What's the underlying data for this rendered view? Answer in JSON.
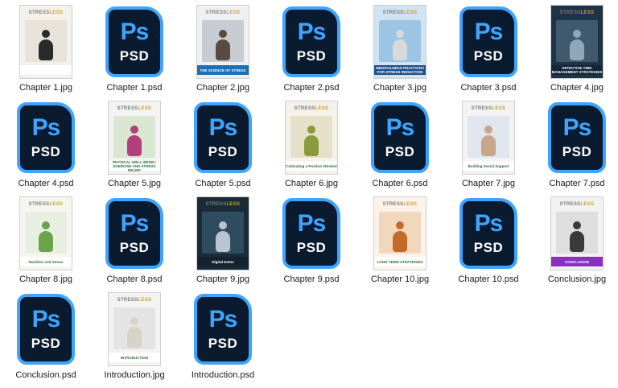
{
  "files": [
    {
      "name": "Chapter 1.jpg",
      "kind": "jpg",
      "theme": {
        "bg": "#f4f1ec",
        "art": "#e7e2da",
        "band": "#ffffff",
        "bandText": "",
        "figure": "#2a2a2a"
      }
    },
    {
      "name": "Chapter 1.psd",
      "kind": "psd"
    },
    {
      "name": "Chapter 2.jpg",
      "kind": "jpg",
      "theme": {
        "bg": "#eef0f2",
        "art": "#c7ccd2",
        "band": "#1c6fb5",
        "bandText": "THE SCIENCE OF STRESS",
        "figure": "#5a4a3f"
      }
    },
    {
      "name": "Chapter 2.psd",
      "kind": "psd"
    },
    {
      "name": "Chapter 3.jpg",
      "kind": "jpg",
      "theme": {
        "bg": "#cfe3f2",
        "art": "#9cc4e4",
        "band": "#1f4f8a",
        "bandText": "MINDFULNESS PRACTICES FOR STRESS REDUCTION",
        "figure": "#d9d9d9"
      }
    },
    {
      "name": "Chapter 3.psd",
      "kind": "psd"
    },
    {
      "name": "Chapter 4.jpg",
      "kind": "jpg",
      "theme": {
        "bg": "#1f3346",
        "art": "#3f5a6f",
        "band": "#13253a",
        "bandText": "EFFECTIVE TIME MANAGEMENT STRATEGIES",
        "figure": "#8fa7b8"
      }
    },
    {
      "name": "Chapter 4.psd",
      "kind": "psd"
    },
    {
      "name": "Chapter 5.jpg",
      "kind": "jpg",
      "theme": {
        "bg": "#f3f3f3",
        "art": "#d8e6d2",
        "band": "#ffffff",
        "bandText": "PHYSICAL WELL-BEING: EXERCISE AND STRESS RELIEF",
        "figure": "#b0407a"
      }
    },
    {
      "name": "Chapter 5.psd",
      "kind": "psd"
    },
    {
      "name": "Chapter 6.jpg",
      "kind": "jpg",
      "theme": {
        "bg": "#f4f2ea",
        "art": "#e6e0c9",
        "band": "#ffffff",
        "bandText": "Cultivating a Positive Mindset",
        "figure": "#8a9a3a"
      }
    },
    {
      "name": "Chapter 6.psd",
      "kind": "psd"
    },
    {
      "name": "Chapter 7.jpg",
      "kind": "jpg",
      "theme": {
        "bg": "#f3f3f3",
        "art": "#dfe6ee",
        "band": "#ffffff",
        "bandText": "Building Social Support",
        "figure": "#c9a68a"
      }
    },
    {
      "name": "Chapter 7.psd",
      "kind": "psd"
    },
    {
      "name": "Chapter 8.jpg",
      "kind": "jpg",
      "theme": {
        "bg": "#f6f6f0",
        "art": "#e8efe0",
        "band": "#ffffff",
        "bandText": "Nutrition and Stress",
        "figure": "#6aa34a"
      }
    },
    {
      "name": "Chapter 8.psd",
      "kind": "psd"
    },
    {
      "name": "Chapter 9.jpg",
      "kind": "jpg",
      "theme": {
        "bg": "#1a2b38",
        "art": "#2f4c5e",
        "band": "#14222e",
        "bandText": "Digital Detox",
        "figure": "#b8c4ce"
      }
    },
    {
      "name": "Chapter 9.psd",
      "kind": "psd"
    },
    {
      "name": "Chapter 10.jpg",
      "kind": "jpg",
      "theme": {
        "bg": "#fbf3ea",
        "art": "#f1d8bd",
        "band": "#ffffff",
        "bandText": "LONG-TERM STRATEGIES",
        "figure": "#c26a2a"
      }
    },
    {
      "name": "Chapter 10.psd",
      "kind": "psd"
    },
    {
      "name": "Conclusion.jpg",
      "kind": "jpg",
      "theme": {
        "bg": "#f2f2f2",
        "art": "#dedede",
        "band": "#8a2fbf",
        "bandText": "CONCLUSION",
        "figure": "#3a3a3a"
      }
    },
    {
      "name": "Conclusion.psd",
      "kind": "psd"
    },
    {
      "name": "Introduction.jpg",
      "kind": "jpg",
      "theme": {
        "bg": "#f3f3f3",
        "art": "#e4e4e4",
        "band": "#ffffff",
        "bandText": "INTRODUCTION",
        "figure": "#d8d2c8"
      }
    },
    {
      "name": "Introduction.psd",
      "kind": "psd"
    }
  ],
  "psd_icon": {
    "ps_text": "Ps",
    "ext_text": "PSD",
    "accent": "#3fa4ff",
    "bg": "#0a1a2f"
  },
  "cover_brand": {
    "prefix": "STRESS",
    "suffix": "LESS"
  }
}
